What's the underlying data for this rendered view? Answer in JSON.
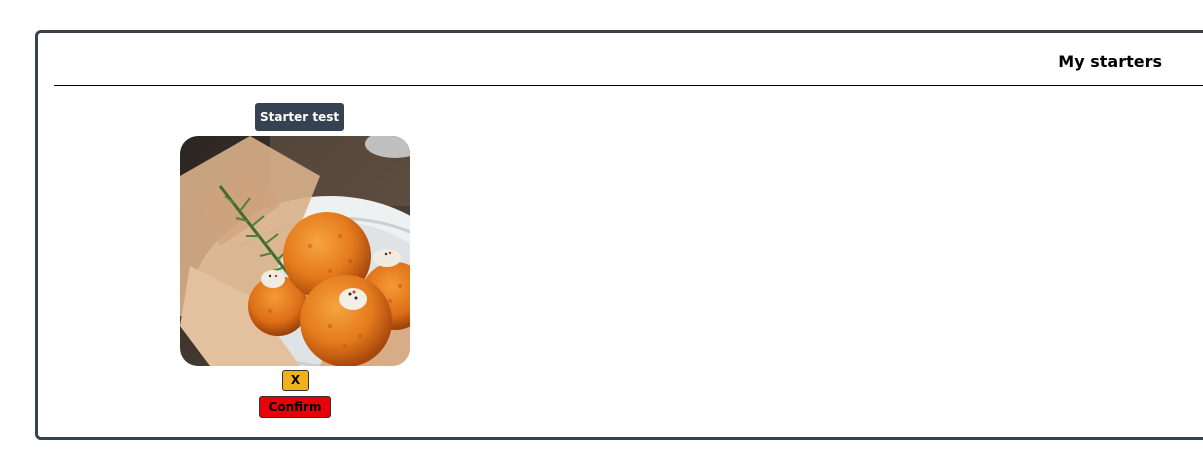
{
  "panel": {
    "title": "My starters"
  },
  "starters": [
    {
      "name": "Starter test",
      "image_icon": "croquettes-photo",
      "remove_label": "X",
      "confirm_label": "Confirm"
    }
  ],
  "colors": {
    "panel_border": "#364152",
    "badge_bg": "#364152",
    "remove_bg": "#f2b01e",
    "confirm_bg": "#e8000b"
  }
}
